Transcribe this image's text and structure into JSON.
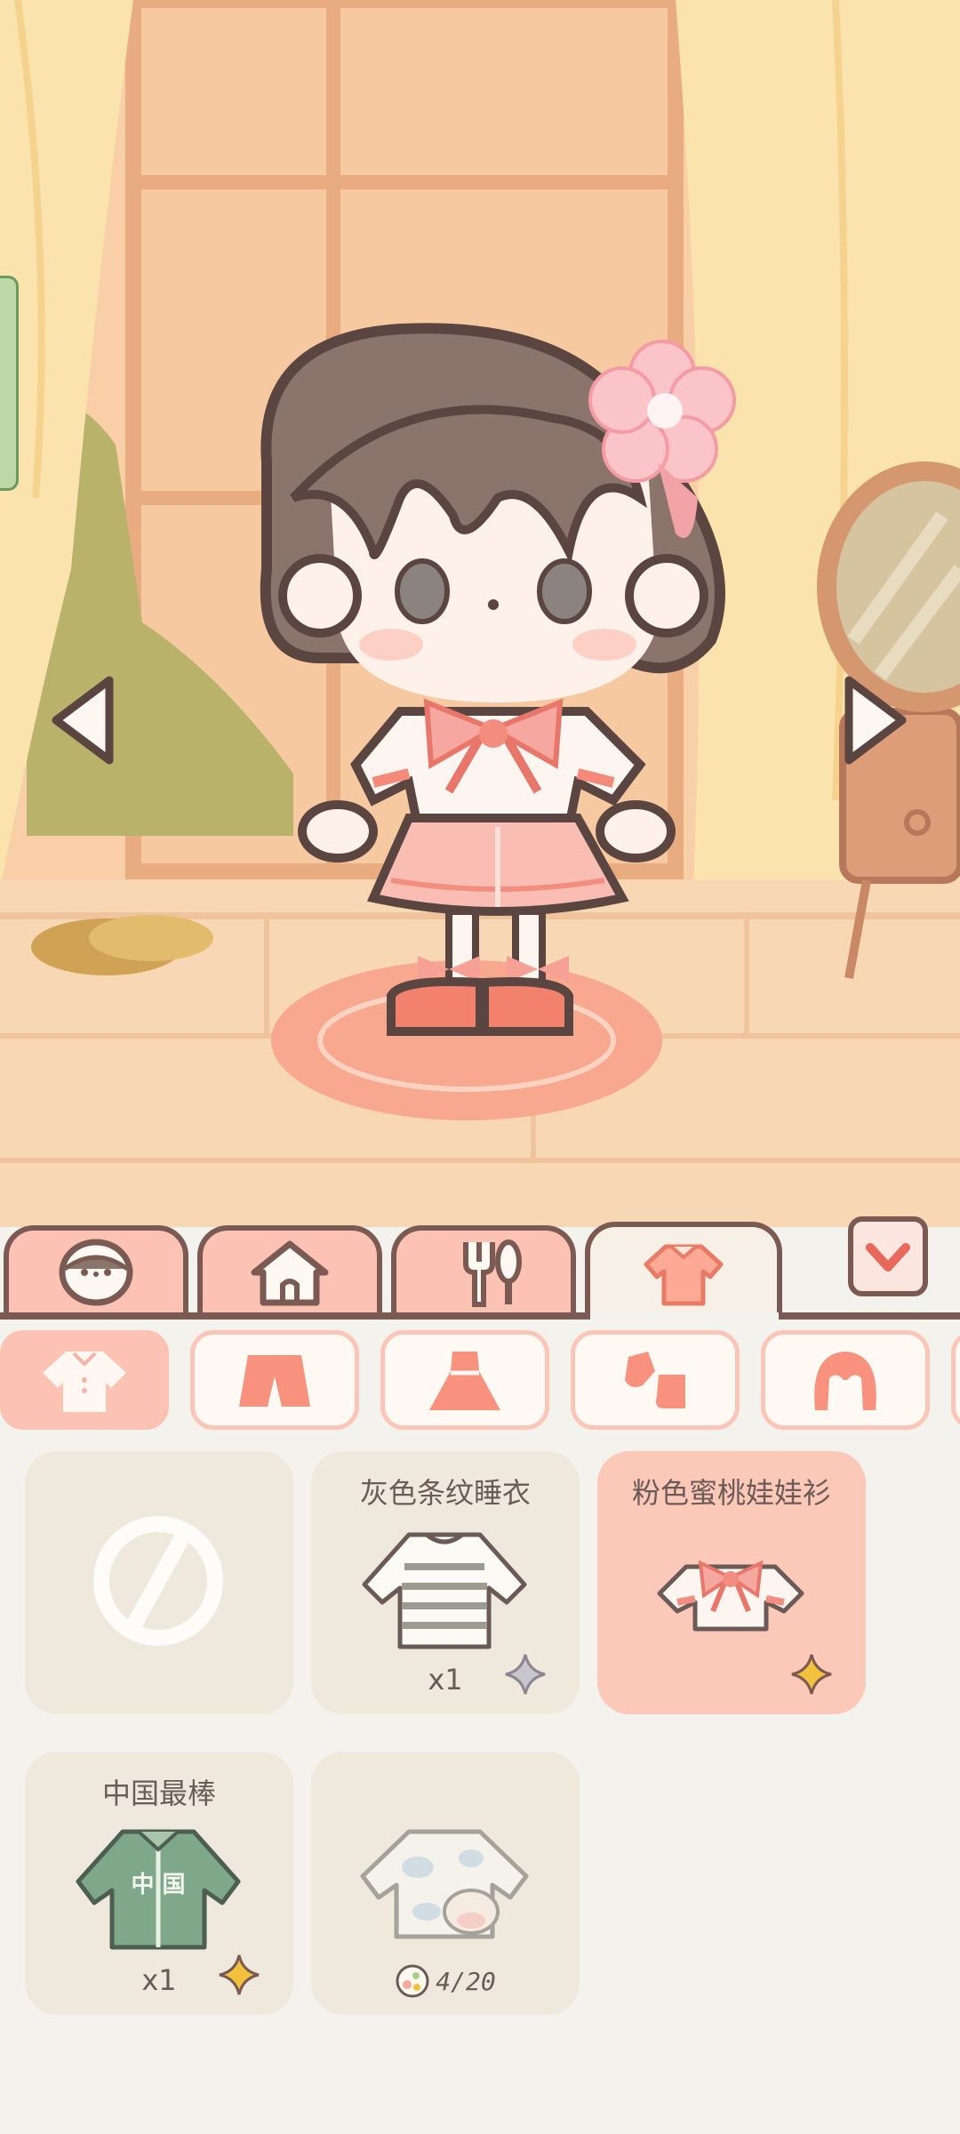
{
  "scene": {
    "arrows": {
      "previous": "previous-character",
      "next": "next-character"
    }
  },
  "category_tabs": [
    {
      "id": "face",
      "icon": "face-icon",
      "active": false
    },
    {
      "id": "home",
      "icon": "house-icon",
      "active": false
    },
    {
      "id": "food",
      "icon": "fork-spoon-icon",
      "active": false
    },
    {
      "id": "clothes",
      "icon": "shirt-icon",
      "active": true
    }
  ],
  "collapse_button": {
    "icon": "chevron-down-icon"
  },
  "sub_tabs": [
    {
      "id": "tops",
      "icon": "top-icon",
      "active": true
    },
    {
      "id": "bottoms",
      "icon": "shorts-icon",
      "active": false
    },
    {
      "id": "dresses",
      "icon": "dress-icon",
      "active": false
    },
    {
      "id": "socks",
      "icon": "socks-icon",
      "active": false
    },
    {
      "id": "hair",
      "icon": "hair-icon",
      "active": false
    }
  ],
  "items": [
    {
      "name": "",
      "icon": "none-icon",
      "quantity": "",
      "selected": false
    },
    {
      "name": "灰色条纹睡衣",
      "icon": "striped-sweater-icon",
      "quantity": "x1",
      "sparkle": "gray",
      "selected": false
    },
    {
      "name": "粉色蜜桃娃娃衫",
      "icon": "pink-blouse-icon",
      "quantity": "",
      "sparkle": "gold",
      "selected": true
    },
    {
      "name": "中国最棒",
      "icon": "green-jacket-icon",
      "quantity": "x1",
      "sparkle": "gold",
      "selected": false
    },
    {
      "name": "",
      "icon": "cow-pajama-icon",
      "progress": "4/20",
      "selected": false
    }
  ],
  "jacket_text": "中 国",
  "colors": {
    "outline": "#7a5a52",
    "tab_pink": "#fcc2b3",
    "card_bg": "#efe8dd",
    "card_selected": "#fcc8b8",
    "sparkle_gold": "#f3c23c",
    "sparkle_gray": "#c9c5cc"
  }
}
